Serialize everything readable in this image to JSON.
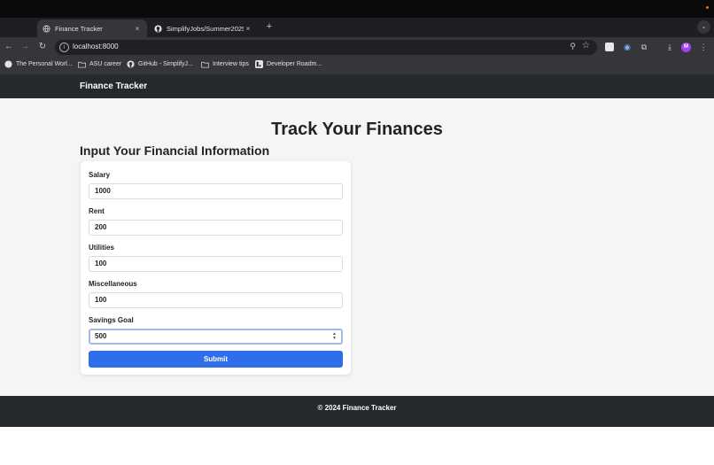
{
  "browser": {
    "tabs": [
      {
        "title": "Finance Tracker",
        "active": true,
        "icon": "globe-icon"
      },
      {
        "title": "SimplifyJobs/Summer2025-I",
        "active": false,
        "icon": "github-icon"
      }
    ],
    "new_tab_label": "+",
    "close_label": "×",
    "url": "localhost:8000",
    "bookmarks": [
      {
        "label": "The Personal Worl...",
        "icon": "globe-icon"
      },
      {
        "label": "ASU career",
        "icon": "folder-icon"
      },
      {
        "label": "GitHub - SimplifyJ...",
        "icon": "github-icon"
      },
      {
        "label": "Interview tips",
        "icon": "folder-icon"
      },
      {
        "label": "Developer Roadm...",
        "icon": "roadmap-icon"
      }
    ],
    "profile_initial": "M"
  },
  "app": {
    "brand": "Finance Tracker",
    "heading": "Track Your Finances",
    "form_title": "Input Your Financial Information",
    "fields": [
      {
        "label": "Salary",
        "value": "1000"
      },
      {
        "label": "Rent",
        "value": "200"
      },
      {
        "label": "Utilities",
        "value": "100"
      },
      {
        "label": "Miscellaneous",
        "value": "100"
      },
      {
        "label": "Savings Goal",
        "value": "500"
      }
    ],
    "submit_label": "Submit",
    "footer": "© 2024 Finance Tracker"
  },
  "colors": {
    "accent": "#2e6ee8",
    "navbar": "#25282c",
    "page_bg": "#f5f5f5"
  }
}
